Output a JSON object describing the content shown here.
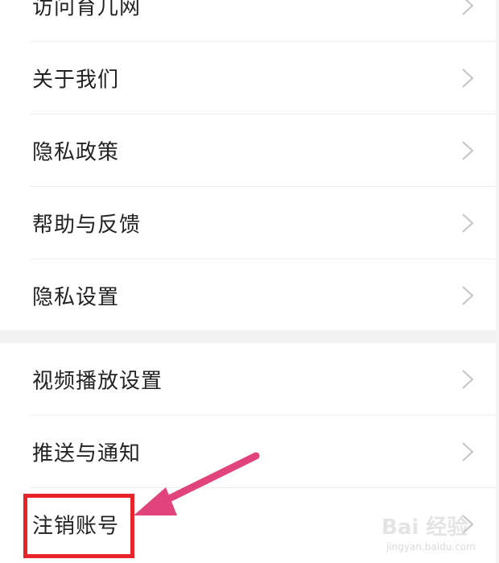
{
  "settings": {
    "group1": [
      {
        "id": "visit",
        "label": "访问育儿网"
      },
      {
        "id": "about",
        "label": "关于我们"
      },
      {
        "id": "privacy-policy",
        "label": "隐私政策"
      },
      {
        "id": "help-feedback",
        "label": "帮助与反馈"
      },
      {
        "id": "privacy-settings",
        "label": "隐私设置"
      }
    ],
    "group2": [
      {
        "id": "video-playback",
        "label": "视频播放设置"
      },
      {
        "id": "push-notify",
        "label": "推送与通知"
      },
      {
        "id": "cancel-account",
        "label": "注销账号"
      }
    ]
  },
  "annotation": {
    "highlight_color": "#e8232a",
    "arrow_color": "#e0447a"
  },
  "watermark": {
    "brand": "Bai 经验",
    "site": "jingyan.baidu.com"
  },
  "icons": {
    "chevron": "chevron-right-icon"
  }
}
